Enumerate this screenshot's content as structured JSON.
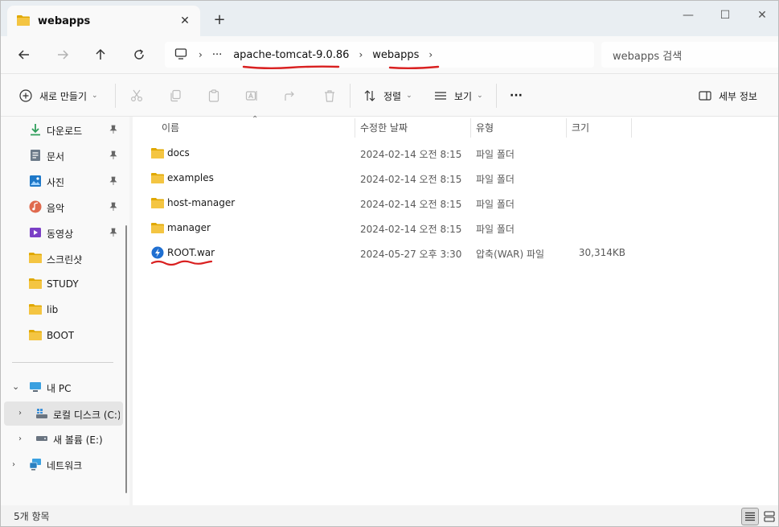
{
  "tab": {
    "title": "webapps",
    "close_symbol": "✕",
    "new_tab_symbol": "+"
  },
  "window_controls": {
    "minimize": "—",
    "maximize": "☐",
    "close": "✕"
  },
  "address_bar": {
    "more_symbol": "···",
    "crumbs": [
      "apache-tomcat-9.0.86",
      "webapps"
    ],
    "separator": "›"
  },
  "search": {
    "placeholder": "webapps 검색"
  },
  "command_bar": {
    "new_label": "새로 만들기",
    "sort_label": "정렬",
    "view_label": "보기",
    "more_symbol": "···",
    "details_label": "세부 정보"
  },
  "nav_pane": {
    "quick_access": [
      {
        "label": "다운로드",
        "icon": "download-icon",
        "pinned": true
      },
      {
        "label": "문서",
        "icon": "document-icon",
        "pinned": true
      },
      {
        "label": "사진",
        "icon": "picture-icon",
        "pinned": true
      },
      {
        "label": "음악",
        "icon": "music-icon",
        "pinned": true
      },
      {
        "label": "동영상",
        "icon": "video-icon",
        "pinned": true
      },
      {
        "label": "스크린샷",
        "icon": "folder-icon",
        "pinned": false
      },
      {
        "label": "STUDY",
        "icon": "folder-icon",
        "pinned": false
      },
      {
        "label": "lib",
        "icon": "folder-icon",
        "pinned": false
      },
      {
        "label": "BOOT",
        "icon": "folder-icon",
        "pinned": false
      }
    ],
    "this_pc": "내 PC",
    "local_disk": "로컬 디스크 (C:)",
    "new_volume": "새 볼륨 (E:)",
    "network": "네트워크"
  },
  "columns": {
    "name": "이름",
    "date": "수정한 날짜",
    "type": "유형",
    "size": "크기"
  },
  "files": [
    {
      "name": "docs",
      "date": "2024-02-14 오전 8:15",
      "type": "파일 폴더",
      "size": "",
      "icon": "folder-icon"
    },
    {
      "name": "examples",
      "date": "2024-02-14 오전 8:15",
      "type": "파일 폴더",
      "size": "",
      "icon": "folder-icon"
    },
    {
      "name": "host-manager",
      "date": "2024-02-14 오전 8:15",
      "type": "파일 폴더",
      "size": "",
      "icon": "folder-icon"
    },
    {
      "name": "manager",
      "date": "2024-02-14 오전 8:15",
      "type": "파일 폴더",
      "size": "",
      "icon": "folder-icon"
    },
    {
      "name": "ROOT.war",
      "date": "2024-05-27 오후 3:30",
      "type": "압축(WAR) 파일",
      "size": "30,314KB",
      "icon": "war-file-icon"
    }
  ],
  "status": {
    "item_count": "5개 항목"
  },
  "colors": {
    "folder": "#f4c542",
    "folder_dark": "#e0a800",
    "annotation": "#d92020",
    "accent": "#0067c0"
  }
}
